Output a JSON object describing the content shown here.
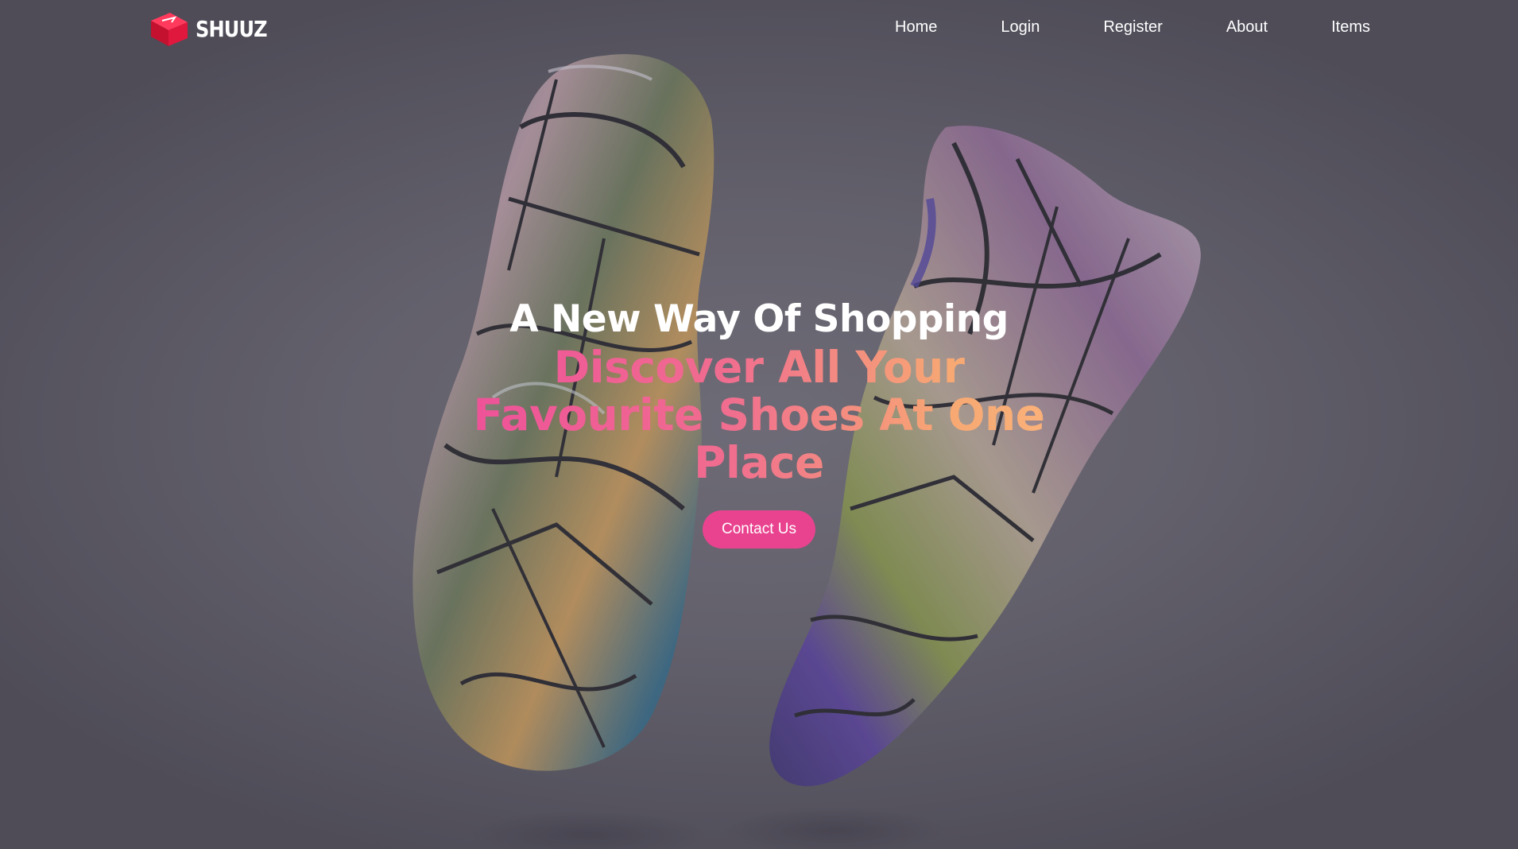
{
  "brand": {
    "name": "SHUUZ",
    "logo_icon": "red-shoebox-logo-icon",
    "accent": "#e8173f"
  },
  "nav": {
    "items": [
      {
        "label": "Home"
      },
      {
        "label": "Login"
      },
      {
        "label": "Register"
      },
      {
        "label": "About"
      },
      {
        "label": "Items"
      }
    ]
  },
  "hero": {
    "tagline": "A New Way Of Shopping",
    "headline_lines": [
      "Discover All Your",
      "Favourite Shoes At One",
      "Place"
    ],
    "cta_label": "Contact Us",
    "cta_color": "#e9438f",
    "headline_gradient": [
      "#ee4f9a",
      "#fbb47a"
    ],
    "background_image": "floating-graffiti-sneakers"
  }
}
